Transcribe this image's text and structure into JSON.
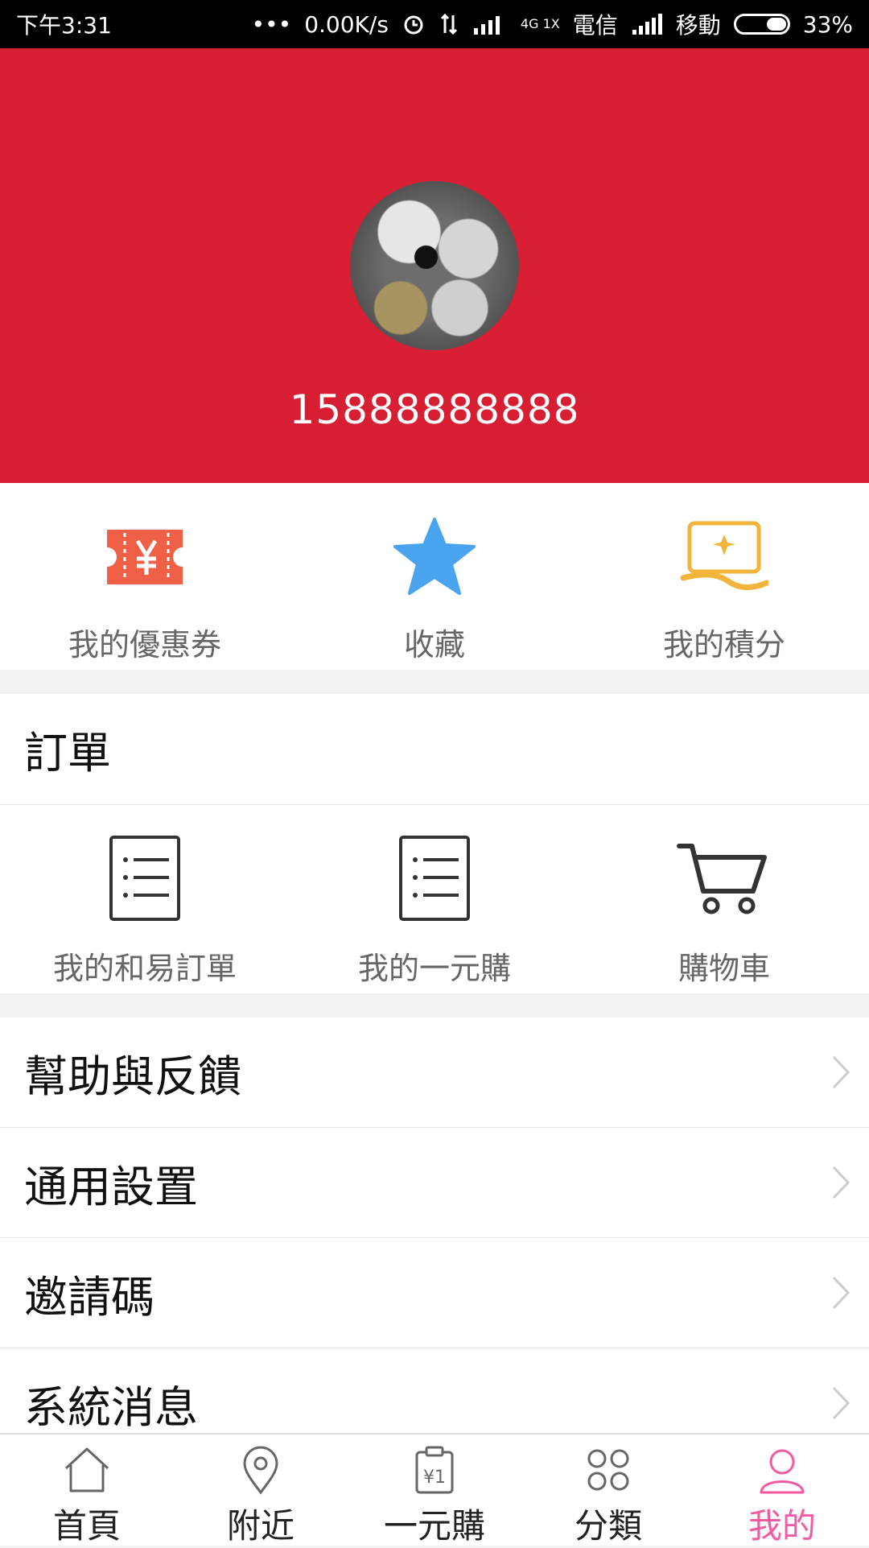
{
  "status_bar": {
    "time": "下午3:31",
    "dots": "•••",
    "speed": "0.00K/s",
    "net_type": "4G 1X",
    "carrier1": "電信",
    "carrier2": "移動",
    "battery": "33%"
  },
  "profile": {
    "phone": "15888888888"
  },
  "quick_actions": [
    {
      "label": "我的優惠券",
      "icon": "coupon-icon"
    },
    {
      "label": "收藏",
      "icon": "star-icon"
    },
    {
      "label": "我的積分",
      "icon": "points-icon"
    }
  ],
  "orders": {
    "title": "訂單",
    "items": [
      {
        "label": "我的和易訂單",
        "icon": "list-icon"
      },
      {
        "label": "我的一元購",
        "icon": "list-icon"
      },
      {
        "label": "購物車",
        "icon": "cart-icon"
      }
    ]
  },
  "menu": [
    {
      "label": "幫助與反饋"
    },
    {
      "label": "通用設置"
    },
    {
      "label": "邀請碼"
    },
    {
      "label": "系統消息"
    }
  ],
  "bottom_nav": [
    {
      "label": "首頁",
      "icon": "home-icon"
    },
    {
      "label": "附近",
      "icon": "location-icon"
    },
    {
      "label": "一元購",
      "icon": "one-yuan-icon"
    },
    {
      "label": "分類",
      "icon": "category-icon"
    },
    {
      "label": "我的",
      "icon": "profile-icon",
      "active": true
    }
  ],
  "colors": {
    "header": "#d81e33",
    "active_tab": "#f35aa2",
    "coupon": "#f06046",
    "star": "#4aa3ee",
    "points": "#f2b43a"
  }
}
